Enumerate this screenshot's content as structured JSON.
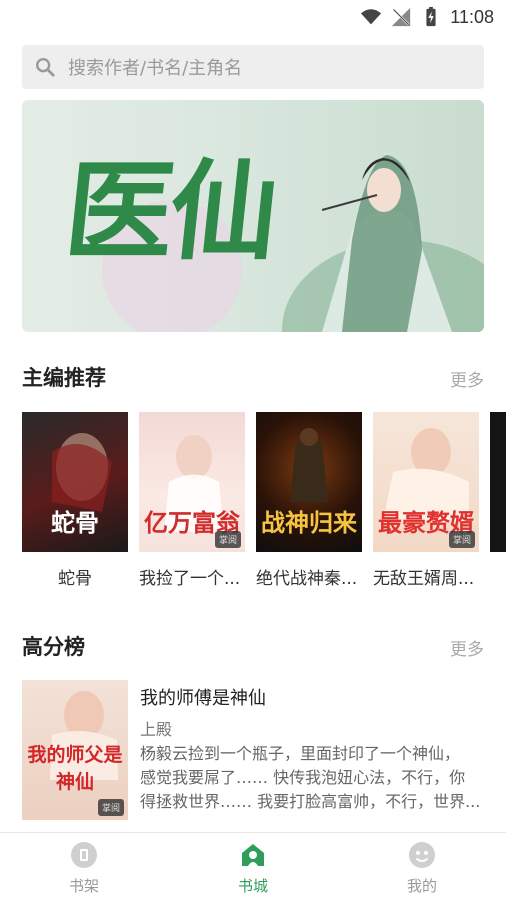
{
  "status": {
    "time": "11:08",
    "icons": [
      "wifi-icon",
      "signal-off-icon",
      "battery-charging-icon"
    ]
  },
  "search": {
    "placeholder": "搜索作者/书名/主角名"
  },
  "banner": {
    "title": "医仙"
  },
  "editor_picks": {
    "title": "主编推荐",
    "more": "更多",
    "books": [
      {
        "title": "蛇骨",
        "cover_text": "蛇骨",
        "badge": ""
      },
      {
        "title": "我捡了一个...",
        "cover_text": "亿万富翁",
        "badge": "掌阅"
      },
      {
        "title": "绝代战神秦...",
        "cover_text": "战神归来",
        "badge": ""
      },
      {
        "title": "无敌王婿周...",
        "cover_text": "最豪赘婿",
        "badge": "掌阅"
      }
    ]
  },
  "top_rated": {
    "title": "高分榜",
    "more": "更多",
    "items": [
      {
        "title": "我的师傅是神仙",
        "author": "上殿",
        "cover_text": "我的师父是神仙",
        "badge": "掌阅",
        "desc_lines": [
          "杨毅云捡到一个瓶子，里面封印了一个神仙，",
          "感觉我要屌了…… 快传我泡妞心法，不行，你",
          "得拯救世界…… 我要打脸高富帅，不行，世界..."
        ]
      }
    ]
  },
  "tabs": [
    {
      "label": "书架",
      "icon": "bookshelf-icon",
      "active": false
    },
    {
      "label": "书城",
      "icon": "bookstore-icon",
      "active": true
    },
    {
      "label": "我的",
      "icon": "profile-icon",
      "active": false
    }
  ],
  "colors": {
    "accent": "#2f9e5a",
    "inactive": "#999999",
    "search_bg": "#eeeeee"
  }
}
